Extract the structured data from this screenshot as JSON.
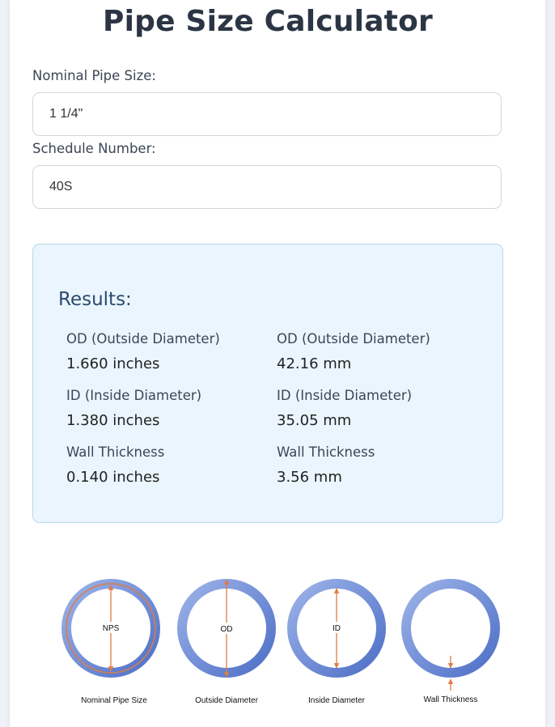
{
  "title": "Pipe Size Calculator",
  "form": {
    "nps_label": "Nominal Pipe Size:",
    "nps_value": "1 1/4\"",
    "schedule_label": "Schedule Number:",
    "schedule_value": "40S"
  },
  "results": {
    "heading": "Results:",
    "rows": [
      {
        "left_label": "OD (Outside Diameter)",
        "left_value": "1.660 inches",
        "right_label": "OD (Outside Diameter)",
        "right_value": "42.16 mm"
      },
      {
        "left_label": "ID (Inside Diameter)",
        "left_value": "1.380 inches",
        "right_label": "ID (Inside Diameter)",
        "right_value": "35.05 mm"
      },
      {
        "left_label": "Wall Thickness",
        "left_value": "0.140 inches",
        "right_label": "Wall Thickness",
        "right_value": "3.56 mm"
      }
    ]
  },
  "diagram": {
    "colors": {
      "ring": "#6f8fd6",
      "arrow": "#e07b45"
    },
    "items": [
      {
        "ring_label": "NPS",
        "caption": "Nominal Pipe Size"
      },
      {
        "ring_label": "OD",
        "caption": "Outside Diameter"
      },
      {
        "ring_label": "ID",
        "caption": "Inside Diameter"
      },
      {
        "ring_label": "",
        "caption": "Wall Thickness"
      }
    ]
  }
}
